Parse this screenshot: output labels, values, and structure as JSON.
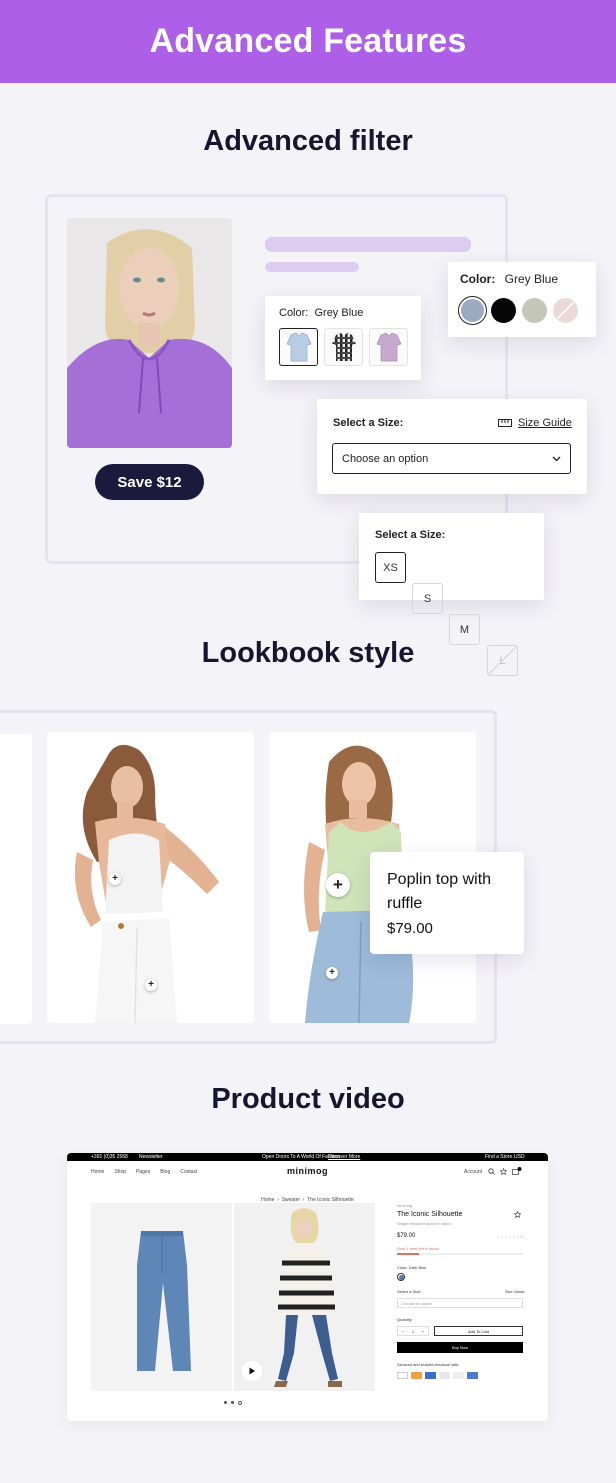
{
  "banner": {
    "title": "Advanced Features"
  },
  "sections": {
    "filter": "Advanced filter",
    "lookbook": "Lookbook style",
    "video": "Product video"
  },
  "filter": {
    "save_label": "Save $12",
    "color_small": {
      "label": "Color:",
      "value": "Grey Blue"
    },
    "color_large": {
      "label": "Color:",
      "value": "Grey Blue",
      "swatches": [
        "#9ba9c1",
        "#050505",
        "#c4c6b7",
        "#ecd8d8"
      ]
    },
    "size_dropdown": {
      "label": "Select a Size:",
      "guide": "Size Guide",
      "placeholder": "Choose an option"
    },
    "size_buttons": {
      "label": "Select a Size:",
      "sizes": [
        "XS",
        "S",
        "M",
        "L"
      ]
    }
  },
  "lookbook": {
    "popup": {
      "name": "Poplin top with ruffle",
      "price": "$79.00"
    }
  },
  "video": {
    "topbar": {
      "phone": "+391 (0)35 2568",
      "newsletter": "Newsletter",
      "promo": "Open Doors To A World Of Fashion",
      "discover": "Discover More",
      "store": "Find a Store",
      "currency": "USD"
    },
    "nav": [
      "Home",
      "Shop",
      "Pages",
      "Blog",
      "Contact"
    ],
    "logo": "minimog",
    "account": "Account",
    "breadcrumb": [
      "Home",
      "Sweater",
      "The Iconic Silhouette"
    ],
    "product": {
      "vendor": "minimog",
      "title": "The Iconic Silhouette",
      "subtitle": "Single breasted jacket in fabric",
      "price": "$79.00",
      "stock": "Only 1 item left in stock!",
      "color_label": "Color: Dark Blue",
      "size_label": "Select a Size:",
      "size_guide": "Size Guide",
      "size_placeholder": "Choose an option",
      "qty_label": "Quantity",
      "qty": "1",
      "add_to_cart": "Add To Cart",
      "buy_now": "Buy Now",
      "secured": "Secured and trusted checkout with:"
    },
    "colors": {
      "accent": "#e1705d",
      "dark": "#000000"
    }
  },
  "colors": {
    "banner": "#ad5fe8",
    "title": "#18162e",
    "button": "#1c1a3c",
    "skeleton": "#dccdf0"
  }
}
